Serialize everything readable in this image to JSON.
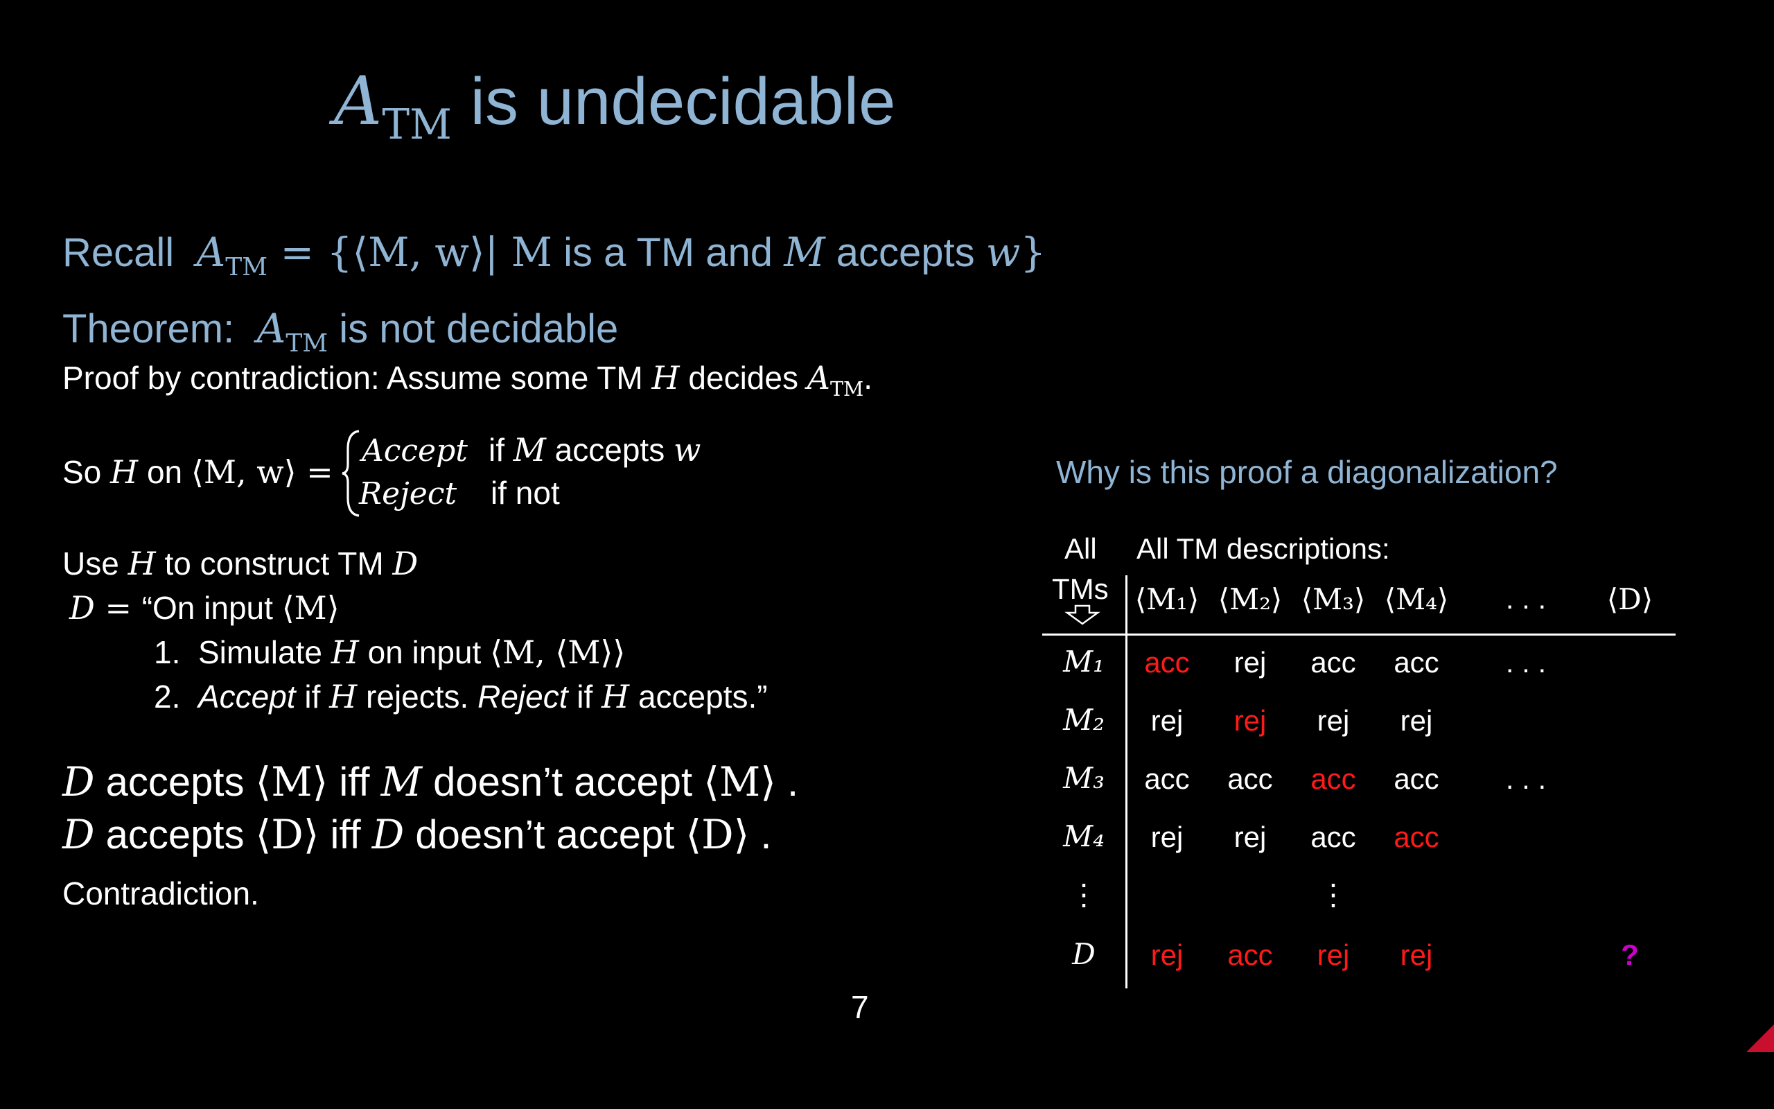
{
  "slide": {
    "title_math": "A",
    "title_sub": "TM",
    "title_text": " is undecidable",
    "recall": {
      "label": "Recall",
      "A": "A",
      "sub": "TM",
      "def_math": " = {⟨M, w⟩| M",
      "mid1": " is a TM and ",
      "M2": "M",
      "mid2": " accepts ",
      "w": "w",
      "close": "}"
    },
    "theorem": {
      "label": "Theorem:",
      "A": "A",
      "sub": "TM",
      "rest": " is not decidable"
    },
    "proof": {
      "lead": "Proof by contradiction:   Assume some TM ",
      "H": "H",
      "mid": " decides ",
      "A": "A",
      "sub": "TM",
      "end": "."
    },
    "so": {
      "lead": "So ",
      "H": "H",
      "on": " on ",
      "input": "⟨M, w⟩ =",
      "accept": "Accept",
      "accept_cond_pre": "if ",
      "accept_cond_M": "M",
      "accept_cond_post": " accepts ",
      "accept_cond_w": "w",
      "reject": "Reject",
      "reject_cond": "if not"
    },
    "construct": {
      "lead": "Use ",
      "H": "H",
      "rest": " to construct TM ",
      "D": "D"
    },
    "d_def": {
      "D": "D",
      "eq": " = ",
      "text": "“On input ",
      "m": "⟨M⟩"
    },
    "step1": {
      "num": "1.",
      "pre": "Simulate ",
      "H": "H",
      "mid": " on input ",
      "m": "⟨M, ⟨M⟩⟩"
    },
    "step2": {
      "num": "2.",
      "accept": "Accept",
      "if1": " if  ",
      "H1": "H",
      "rej": " rejects.  ",
      "reject": "Reject",
      "if2": " if ",
      "H2": "H",
      "acc": " accepts.”"
    },
    "line1": {
      "D": "D",
      "a": " accepts ",
      "m1": "⟨M⟩",
      "iff": "  iff  ",
      "M": "M",
      "b": " doesn’t accept ",
      "m2": "⟨M⟩",
      "end": " ."
    },
    "line2": {
      "D": "D",
      "a": " accepts ",
      "m1": "⟨D⟩",
      "iff": "  iff  ",
      "D2": "D",
      "b": " doesn’t accept  ",
      "m2": "⟨D⟩",
      "end": " ."
    },
    "contradiction": "Contradiction.",
    "page_number": "7",
    "why": "Why is this proof a diagonalization?",
    "table": {
      "all_label": "All",
      "tms_label": "TMs",
      "header_label": "All TM descriptions:",
      "columns": [
        "⟨M₁⟩",
        "⟨M₂⟩",
        "⟨M₃⟩",
        "⟨M₄⟩",
        ". . .",
        "⟨D⟩"
      ],
      "rows": [
        {
          "label": "M₁",
          "cells": [
            "acc",
            "rej",
            "acc",
            "acc",
            ". . .",
            ""
          ]
        },
        {
          "label": "M₂",
          "cells": [
            "rej",
            "rej",
            "rej",
            "rej",
            "",
            ""
          ]
        },
        {
          "label": "M₃",
          "cells": [
            "acc",
            "acc",
            "acc",
            "acc",
            ". . .",
            ""
          ]
        },
        {
          "label": "M₄",
          "cells": [
            "rej",
            "rej",
            "acc",
            "acc",
            "",
            ""
          ]
        },
        {
          "label": "⋮",
          "cells": [
            "",
            "",
            "⋮",
            "",
            "",
            ""
          ]
        },
        {
          "label": "D",
          "cells": [
            "rej",
            "acc",
            "rej",
            "rej",
            "",
            "?"
          ]
        }
      ]
    },
    "colors": {
      "heading_blue": "#8fb4d4",
      "diagonal_red": "#ff1a1a",
      "question_magenta": "#cc00cc",
      "background": "#000000"
    }
  }
}
